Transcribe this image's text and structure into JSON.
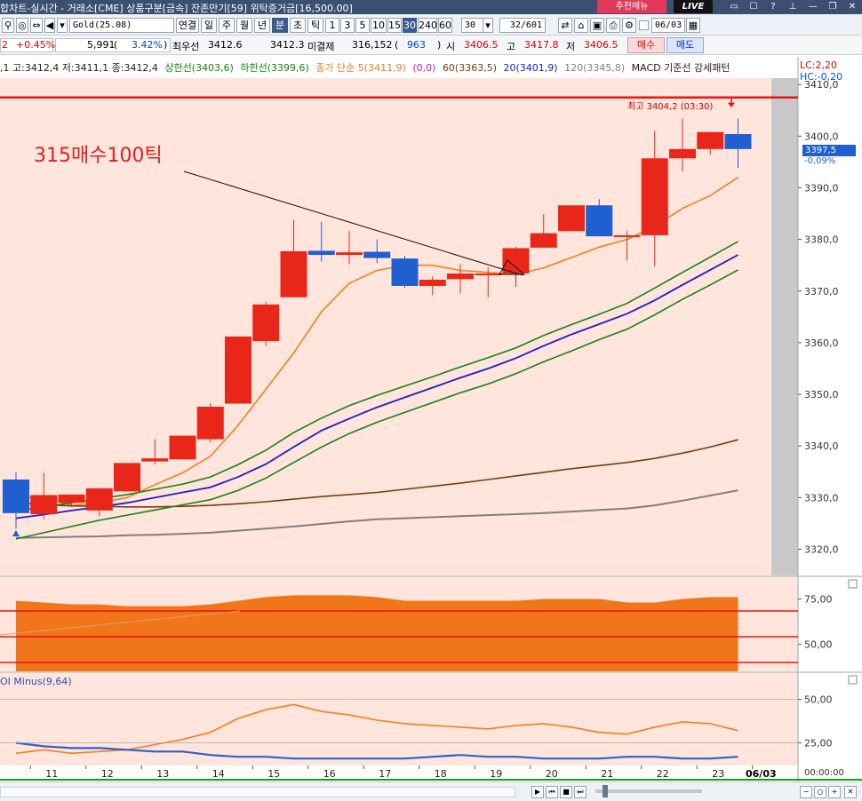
{
  "window": {
    "title": "합차트-실시간 - 거래소[CME] 상품구분[금속] 잔존만기[59] 위탁증거금[16,500.00]",
    "badge_recommend": "추천메뉴",
    "badge_live": "LIVE"
  },
  "toolbar": {
    "symbol": "Gold(25.08)",
    "periods": [
      "연결",
      "일",
      "주",
      "월",
      "년",
      "분",
      "초",
      "틱"
    ],
    "active_period": "분",
    "intervals": [
      "1",
      "3",
      "5",
      "10",
      "15",
      "30",
      "240",
      "60"
    ],
    "active_interval": "30",
    "count_value": "30",
    "page_value": "32/601",
    "date_value": "06/03"
  },
  "quote": {
    "change_price": "2",
    "change_pct": "+0.45%",
    "volume": "5,991",
    "volume_pct": "3.42%",
    "best_bid_label": "최우선",
    "best_bid": "3412.6",
    "best_ask": "3412.3",
    "open_interest_label": "미결제",
    "open_interest": "316,152",
    "oi_change": "963",
    "open_label": "시",
    "open": "3406.5",
    "high_label": "고",
    "high": "3417.8",
    "low_label": "저",
    "low": "3406.5",
    "buy_label": "매수",
    "sell_label": "매도"
  },
  "legend": {
    "ohlc": ",1 고:3412,4 저:3411,1 종:3412,4",
    "upper": "상한선(3403,6)",
    "lower": "하한선(3399,6)",
    "sma": "종가 단순 5(3411,9)",
    "ma0": "(0,0)",
    "ma60": "60(3363,5)",
    "ma20": "20(3401,9)",
    "ma120": "120(3345,8)",
    "macd": "MACD 기준선 강세패턴",
    "lc": "LC:2,20",
    "hc": "HC:-0,20"
  },
  "colors": {
    "up": "#e8271a",
    "down": "#1f5fd0",
    "bg_main": "#ffe5dc",
    "ma5": "#ef7f22",
    "ma20": "#1c1cd0",
    "band": "#188018",
    "ma60": "#7a3a12",
    "ma120": "#7f7f7f",
    "hline": "#e81414"
  },
  "annotations": {
    "note": "315매수100틱",
    "high_note": "최고 3404,2 (03:30)"
  },
  "price_now": {
    "price": "3397,5",
    "change": "-0,09%"
  },
  "sub2_legend": "OI Minus(9,64)",
  "time_label": "00:00:00",
  "chart_data": {
    "type": "candlestick",
    "y_ticks": [
      "3410,0",
      "3400,0",
      "3390,0",
      "3380,0",
      "3370,0",
      "3360,0",
      "3350,0",
      "3340,0",
      "3330,0",
      "3320,0"
    ],
    "ylim": [
      3314,
      3411
    ],
    "x_ticks": [
      "11",
      "12",
      "13",
      "14",
      "15",
      "16",
      "17",
      "18",
      "19",
      "20",
      "21",
      "22",
      "23",
      "06/03"
    ],
    "candles": [
      {
        "o": 3333.5,
        "h": 3335,
        "c": 3327,
        "l": 3324
      },
      {
        "o": 3326.8,
        "h": 3334.8,
        "c": 3330.5,
        "l": 3325.8
      },
      {
        "o": 3329,
        "h": 3330.6,
        "c": 3330.6,
        "l": 3328.2
      },
      {
        "o": 3327.5,
        "h": 3331.8,
        "c": 3331.8,
        "l": 3326.4
      },
      {
        "o": 3331.2,
        "h": 3336.7,
        "c": 3336.7,
        "l": 3331.2
      },
      {
        "o": 3337,
        "h": 3341.3,
        "c": 3337.6,
        "l": 3336.4
      },
      {
        "o": 3337.4,
        "h": 3342,
        "c": 3342,
        "l": 3337.4
      },
      {
        "o": 3341.3,
        "h": 3348.3,
        "c": 3347.6,
        "l": 3340.7
      },
      {
        "o": 3348.2,
        "h": 3361.2,
        "c": 3361.2,
        "l": 3348.2
      },
      {
        "o": 3360.3,
        "h": 3368,
        "c": 3367.4,
        "l": 3359.4
      },
      {
        "o": 3368.8,
        "h": 3383.7,
        "c": 3377.7,
        "l": 3368.8
      },
      {
        "o": 3377.8,
        "h": 3383.4,
        "c": 3377,
        "l": 3375.7
      },
      {
        "o": 3377,
        "h": 3381.6,
        "c": 3377.5,
        "l": 3375.2
      },
      {
        "o": 3377.6,
        "h": 3380,
        "c": 3376.4,
        "l": 3375.4
      },
      {
        "o": 3376.3,
        "h": 3376.8,
        "c": 3371,
        "l": 3370.6
      },
      {
        "o": 3371,
        "h": 3372.8,
        "c": 3372.2,
        "l": 3369.2
      },
      {
        "o": 3372.3,
        "h": 3375.2,
        "c": 3373.4,
        "l": 3369.5
      },
      {
        "o": 3373.4,
        "h": 3374.6,
        "c": 3373.4,
        "l": 3368.8
      },
      {
        "o": 3373.4,
        "h": 3378.6,
        "c": 3378.3,
        "l": 3370.8
      },
      {
        "o": 3378.4,
        "h": 3384.9,
        "c": 3381.2,
        "l": 3378.4
      },
      {
        "o": 3381.6,
        "h": 3386.6,
        "c": 3386.6,
        "l": 3381.6
      },
      {
        "o": 3386.6,
        "h": 3387.8,
        "c": 3380.6,
        "l": 3380.6
      },
      {
        "o": 3380.6,
        "h": 3381.6,
        "c": 3380.8,
        "l": 3375.9
      },
      {
        "o": 3380.8,
        "h": 3401,
        "c": 3395.7,
        "l": 3374.8
      },
      {
        "o": 3395.7,
        "h": 3403.4,
        "c": 3397.5,
        "l": 3393.2
      },
      {
        "o": 3397.5,
        "h": 3400.8,
        "c": 3400.8,
        "l": 3396.4
      },
      {
        "o": 3400.4,
        "h": 3403.4,
        "c": 3397.5,
        "l": 3393.8
      }
    ],
    "series": [
      {
        "name": "종가 단순 5",
        "values": [
          3330,
          3330,
          3328.5,
          3329,
          3330,
          3332.5,
          3334.8,
          3338,
          3344,
          3351,
          3358,
          3366,
          3371.5,
          3374,
          3375,
          3375,
          3374,
          3373.6,
          3373.2,
          3374.5,
          3376.5,
          3378.5,
          3380,
          3382.5,
          3386,
          3388.5,
          3392
        ]
      },
      {
        "name": "60",
        "values": [
          3329,
          3328.6,
          3328.4,
          3328.3,
          3328.2,
          3328.2,
          3328.3,
          3328.5,
          3328.8,
          3329.2,
          3329.7,
          3330.2,
          3330.6,
          3331,
          3331.6,
          3332.2,
          3332.8,
          3333.5,
          3334.2,
          3334.9,
          3335.6,
          3336.2,
          3336.8,
          3337.6,
          3338.6,
          3339.8,
          3341.2
        ]
      },
      {
        "name": "120",
        "values": [
          3322.2,
          3322.3,
          3322.4,
          3322.5,
          3322.7,
          3322.8,
          3323,
          3323.2,
          3323.6,
          3324,
          3324.4,
          3324.9,
          3325.4,
          3325.8,
          3326,
          3326.2,
          3326.4,
          3326.6,
          3326.8,
          3327,
          3327.3,
          3327.6,
          3327.9,
          3328.5,
          3329.4,
          3330.4,
          3331.4
        ]
      },
      {
        "name": "20",
        "values": [
          3326,
          3326.7,
          3327.5,
          3328.2,
          3329,
          3330,
          3331,
          3332,
          3334,
          3336.5,
          3339.8,
          3343,
          3345.3,
          3347.5,
          3349.4,
          3351.3,
          3353.2,
          3355,
          3357,
          3359.4,
          3361.6,
          3363.6,
          3365.6,
          3368.2,
          3371.2,
          3374.1,
          3377
        ]
      },
      {
        "name": "상한선",
        "values": [
          3327.4,
          3328.2,
          3329,
          3329.8,
          3330.6,
          3331.6,
          3332.6,
          3334,
          3336.4,
          3339.2,
          3342.6,
          3345.4,
          3347.8,
          3349.8,
          3351.6,
          3353.4,
          3355.3,
          3357.1,
          3359,
          3361.4,
          3363.5,
          3365.5,
          3367.6,
          3370.6,
          3373.6,
          3376.6,
          3379.6
        ]
      },
      {
        "name": "하한선",
        "values": [
          3322,
          3323.2,
          3324.4,
          3325.6,
          3326.6,
          3327.6,
          3328.6,
          3329.6,
          3331.4,
          3333.8,
          3336.8,
          3339.8,
          3342.4,
          3344.6,
          3346.5,
          3348.4,
          3350.3,
          3352,
          3354,
          3356.3,
          3358.4,
          3360.6,
          3362.6,
          3365.4,
          3368.4,
          3371.2,
          3374.1
        ]
      }
    ],
    "resistance_level": 3407.5,
    "sub1": {
      "ticks": [
        "75,00",
        "50,00"
      ],
      "ylim": [
        35,
        87
      ],
      "area": [
        74,
        73,
        72,
        72,
        71,
        71,
        71,
        72,
        74,
        76,
        77,
        77,
        77,
        76,
        74,
        74,
        74,
        74,
        74,
        75,
        75,
        75,
        73,
        73,
        75,
        76,
        76
      ]
    },
    "sub2": {
      "ticks": [
        "50,00",
        "25,00"
      ],
      "ylim": [
        12,
        65
      ],
      "orange": [
        19,
        21,
        19,
        20,
        21,
        24,
        27,
        31,
        39,
        44,
        47,
        43,
        41,
        38,
        36,
        35,
        34,
        33,
        35,
        36,
        34,
        31,
        30,
        34,
        37,
        36,
        32
      ],
      "blue": [
        25,
        23,
        22,
        22,
        21,
        20,
        20,
        18,
        17,
        17,
        16,
        16,
        16,
        16,
        16,
        17,
        18,
        17,
        17,
        16,
        16,
        16,
        17,
        17,
        16,
        16,
        17
      ]
    }
  }
}
